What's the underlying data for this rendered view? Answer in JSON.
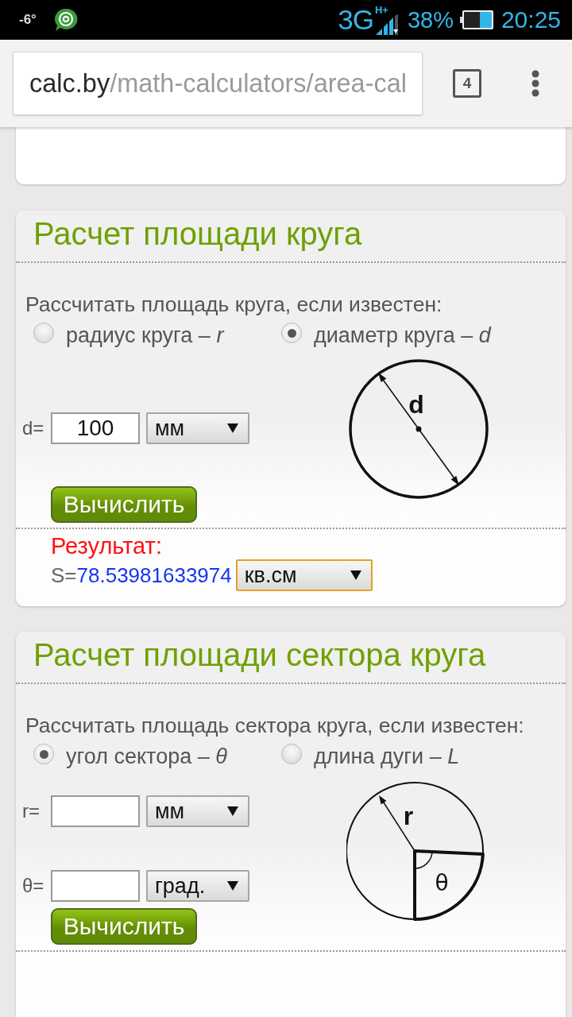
{
  "status_bar": {
    "temperature": "-6°",
    "network": "3G",
    "network_speed": "H+",
    "battery": "38%",
    "time": "20:25"
  },
  "browser": {
    "url_domain": "calc.by",
    "url_path": "/math-calculators/area-cal",
    "tab_count": "4"
  },
  "sections": [
    {
      "title": "Расчет площади круга",
      "prompt": "Рассчитать площадь круга, если известен:",
      "options": [
        {
          "label": "радиус круга – *r*",
          "selected": false
        },
        {
          "label": "диаметр круга – *d*",
          "selected": true
        }
      ],
      "inputs": [
        {
          "label": "d=",
          "value": "100",
          "unit": {
            "value": "мм",
            "focused": false
          }
        }
      ],
      "button": "Вычислить",
      "diagram": {
        "kind": "diameter",
        "labels": [
          "d"
        ]
      },
      "result": {
        "label": "Результат:",
        "variable": "S=",
        "value": "78.53981633974",
        "unit": {
          "value": "кв.см",
          "focused": true
        }
      }
    },
    {
      "title": "Расчет площади сектора круга",
      "prompt": "Рассчитать площадь сектора круга, если известен:",
      "options": [
        {
          "label": "угол сектора – *θ*",
          "selected": true
        },
        {
          "label": "длина дуги – *L*",
          "selected": false
        }
      ],
      "inputs": [
        {
          "label": "r=",
          "unit": {
            "value": "мм",
            "focused": false
          }
        },
        {
          "label": "θ=",
          "unit": {
            "value": "град.",
            "focused": false
          }
        }
      ],
      "button": "Вычислить",
      "diagram": {
        "kind": "sector",
        "labels": [
          "r",
          "θ"
        ]
      }
    }
  ]
}
